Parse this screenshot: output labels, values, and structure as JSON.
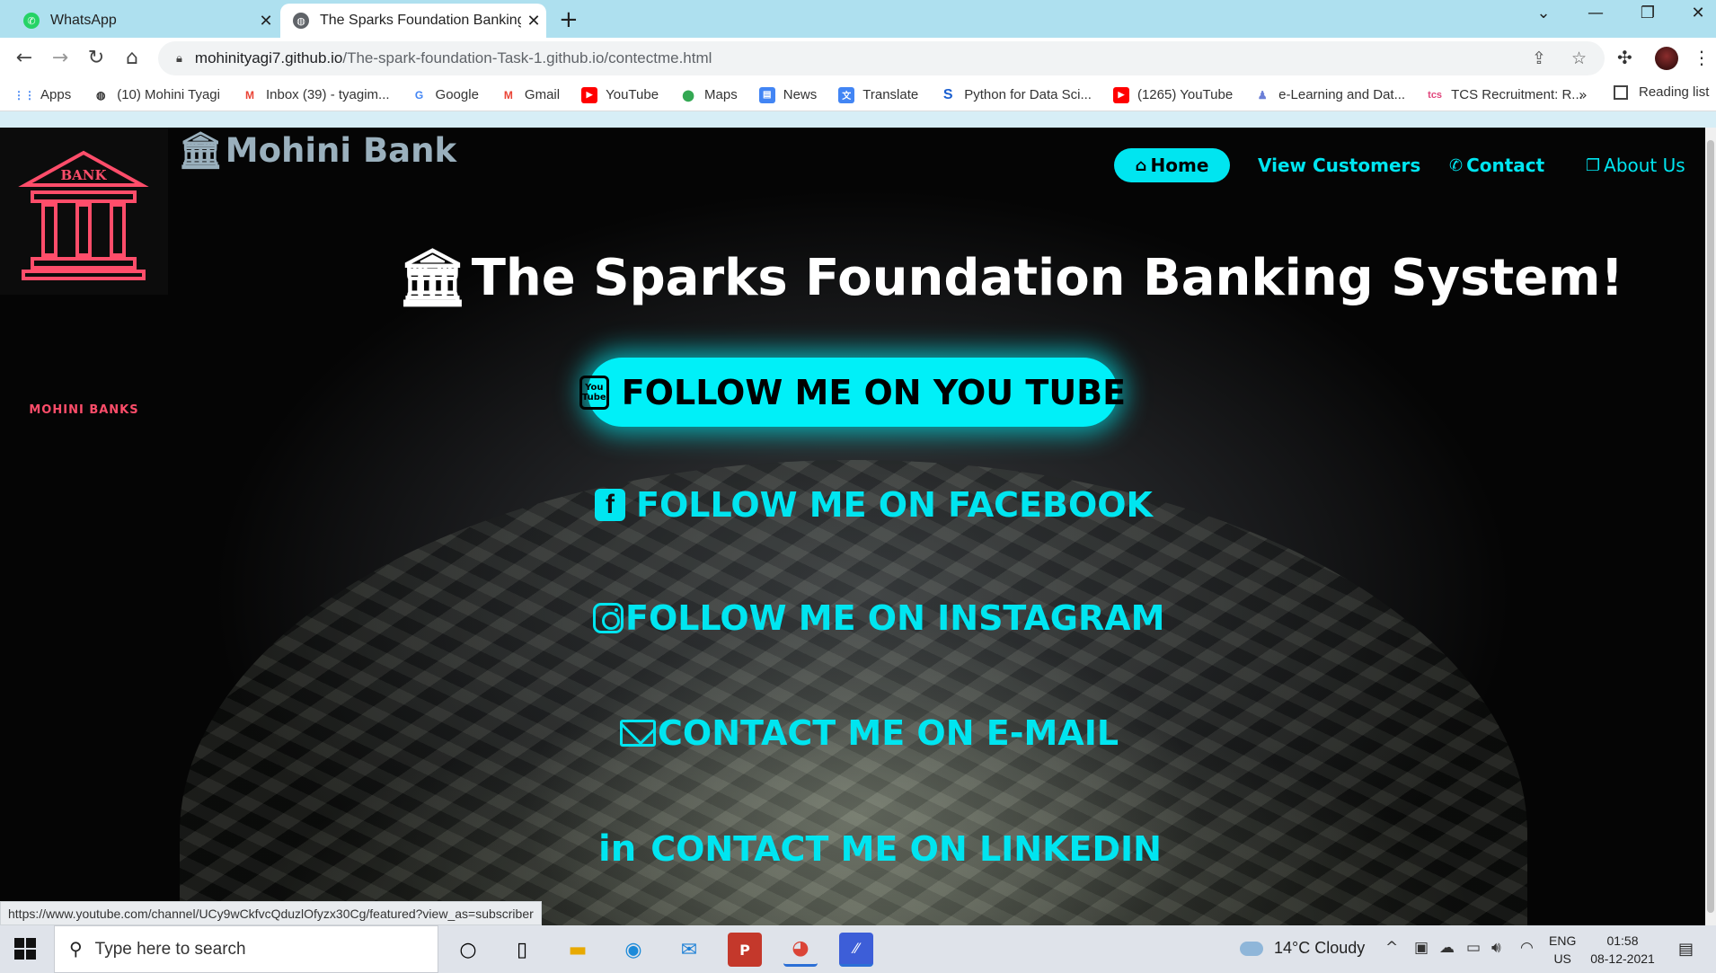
{
  "browser": {
    "tabs": [
      {
        "title": "WhatsApp",
        "icon": "whatsapp-icon",
        "active": false
      },
      {
        "title": "The Sparks Foundation Banking S",
        "icon": "globe-icon",
        "active": true
      }
    ],
    "close_glyph": "✕",
    "new_tab_glyph": "+",
    "url_host": "mohinityagi7.github.io",
    "url_path": "/The-spark-foundation-Task-1.github.io/contectme.html",
    "bookmarks": [
      {
        "label": "Apps",
        "icon": "apps-grid-icon",
        "color": "#4285f4"
      },
      {
        "label": "(10) Mohini Tyagi",
        "icon": "globe-icon",
        "color": "#333333"
      },
      {
        "label": "Inbox (39) - tyagim...",
        "icon": "gmail-icon",
        "color": "#ea4335"
      },
      {
        "label": "Google",
        "icon": "google-icon",
        "color": "#4285f4"
      },
      {
        "label": "Gmail",
        "icon": "gmail-icon",
        "color": "#ea4335"
      },
      {
        "label": "YouTube",
        "icon": "youtube-icon",
        "color": "#ff0000"
      },
      {
        "label": "Maps",
        "icon": "maps-icon",
        "color": "#34a853"
      },
      {
        "label": "News",
        "icon": "news-icon",
        "color": "#4285f4"
      },
      {
        "label": "Translate",
        "icon": "translate-icon",
        "color": "#4285f4"
      },
      {
        "label": "Python for Data Sci...",
        "icon": "s-icon",
        "color": "#1a5fd0"
      },
      {
        "label": "(1265) YouTube",
        "icon": "youtube-icon",
        "color": "#ff0000"
      },
      {
        "label": "e-Learning and Dat...",
        "icon": "elearning-icon",
        "color": "#6b7fd7"
      },
      {
        "label": "TCS Recruitment: R...",
        "icon": "tcs-icon",
        "color": "#e0457b"
      }
    ],
    "more_glyph": "»",
    "reading_list": "Reading list"
  },
  "page": {
    "logo_caption": "MOHINI BANKS",
    "logo_banner": "BANK",
    "brand": "Mohini Bank",
    "nav": {
      "home": "Home",
      "view_customers": "View Customers",
      "contact": "Contact",
      "about": "About Us"
    },
    "hero_title": "The Sparks Foundation Banking System!",
    "social": {
      "youtube": "FOLLOW ME ON YOU TUBE",
      "youtube_icon_top": "You",
      "youtube_icon_bottom": "Tube",
      "facebook": "FOLLOW ME ON FACEBOOK",
      "instagram": "FOLLOW ME ON INSTAGRAM",
      "email": "CONTACT ME ON E-MAIL",
      "linkedin": "CONTACT ME ON LINKEDIN",
      "linkedin_icon": "in"
    },
    "accent_color": "#00e5f0",
    "status_link": "https://www.youtube.com/channel/UCy9wCkfvcQduzlOfyzx30Cg/featured?view_as=subscriber"
  },
  "taskbar": {
    "search_placeholder": "Type here to search",
    "weather": "14°C  Cloudy",
    "lang_top": "ENG",
    "lang_bottom": "US",
    "time": "01:58",
    "date": "08-12-2021"
  }
}
